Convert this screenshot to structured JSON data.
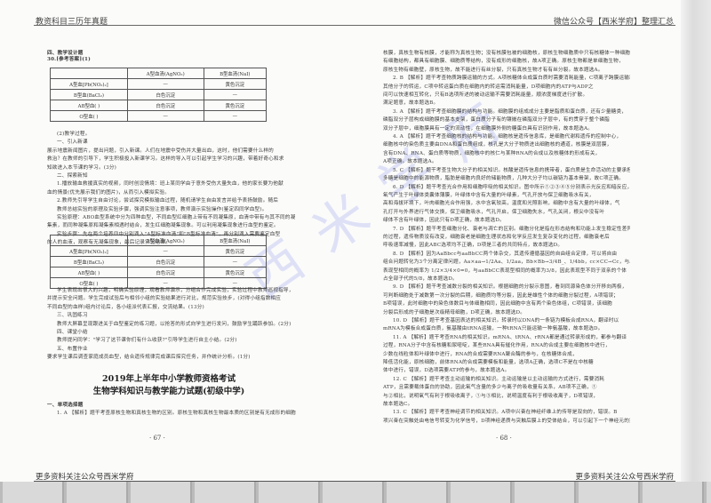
{
  "header": {
    "left": "教资科目三历年真题",
    "right": "微信公众号【西米学府】整理汇总"
  },
  "watermark": "西米学府",
  "left_page": {
    "section": "四、教学设计题",
    "answer_label": "30.[参考答案](1)",
    "table": {
      "headers": [
        "",
        "A型血清(AgNO₃)",
        "B型血清(NaI)"
      ],
      "rows": [
        [
          "A型血[Pb(NO₃)₂]",
          "—",
          "黄色沉淀"
        ],
        [
          "B型血(BaCl₂)",
          "白色沉淀",
          "—"
        ],
        [
          "AB型血(  )",
          "白色沉淀",
          "黄色沉淀"
        ],
        [
          "O型血(  )",
          "—",
          "—"
        ]
      ]
    },
    "para1": [
      "(2)教学过程。",
      "一、引入新课",
      "展示地震新闻图片，提出问题，引入新课。人们在地震中受伤并大量出血，这时，他们需要什么样的",
      "救治？在教师的引导下，学生积极投入新课学习。这样的导入可以引起学生学习的兴趣，带着好奇心和求",
      "知欲进入本节课的学习。(3分)",
      "二、探索新知",
      "1.播放输血救援真实的视频，同时创设情境：班上某同学由于意外受伤大量失血，他的家长要为他献",
      "血的情景(优先展示我们的图片)，从而引入模拟实验。",
      "2.教师先引导学生自由讨论，尝试探究模拟输血过程，随机请学生自由发言并给予表扬鼓励。随后",
      "教师总结实验的原理及实验步骤，强调实验注意事项，教师演示实验操作(鉴定四同学血型)。",
      "实验原理：ABO血型系统中分为四种血型，不同血型红细胞上带有不同凝集原，血清中带有与其不同的凝",
      "集素，而同种凝集原和凝集素相遇时结合，发生红细胞凝集现象。可以利用凝集现象进行血型的鉴定。",
      "实验步骤：先在两个培养皿中分别滴入\"A型标准血清\"和\"B型标准血清\"，再分别滴入需要鉴定血型",
      "的人的血液，观察有无凝集现象，最后记录实验结果。"
    ],
    "para2": [
      "学生表现出很大的兴趣，明确实验原理，观看教师演示，分组合作完成实验，实验过程中教师巡视指导，",
      "并提示安全问题。学生完成试验后与相邻小组的实验结果进行对比，规范实验技步，(对得小组指数相应",
      "不同血型的血样)组内讨论后，各小组派代表汇报，交流结果。(13分)",
      "三、巩固练习",
      "教师大屏幕呈现跟进关于血型鉴定的练习题，以抢答的形式向学生进行发问，鼓励学生踊跃参加。(2分)",
      "四、课堂小结",
      "教师提问同学：\"学习了这节课你们有什么收获?\"引导学生进行自主小结。(2分)",
      "五、布置作业",
      "要求学生课后调查家庭成员血型，结合遗传规律完成课后探究任务，并作统计分析。(1分)"
    ],
    "exam_title_1": "2019年上半年中小学教师资格考试",
    "exam_title_2": "生物学科知识与教学能力试题(初级中学)",
    "section2": "一、单项选择题",
    "q1": "1. A 【解析】题干考查原核生物和真核生物的区别。原核生物和真核生物最本质的区别是有无成形的细胞",
    "page_number": "· 67 ·"
  },
  "right_page": {
    "lines": [
      "核膜，真核生物有核膜，才能称为真核生物；没有核膜包被的细胞核，原核生物细胞质中只有核糖体一种细胞器",
      "有细胞结构，都具有细胞膜、细胞质等结构，没有成形的细胞核，故A项正确。原核生物都是单细胞生物，",
      "原核生物有细胞壁，原核生物，故不能进行有丝分裂，只有真核生物才有有丝分裂。故本题选A。",
      "2. B 【解析】题干考查物质跨膜运输的方式。A项核糖体合成蛋白质时需要消耗能量，C项离子跨膜运输和",
      "其他分子的转运，C项中转运蛋白质在细胞内的转运需消耗能量，D项细胞内的ATP与ADP之",
      "间可以快速相互转化，只有B选项所述的被动运输不需要消耗能量，顺浓度梯度进行扩散。",
      "满足题意，故本题选B。",
      "3. A 【解析】题干考查细胞膜的结构与功能。细胞膜的组成成分主要是脂质和蛋白质，还有少量糖类，",
      "磷脂双分子层构成细胞膜的基本支架，蛋白质分子有的镶嵌在磷脂双分子层中，有的贯穿于整个磷脂",
      "双分子层中，细胞膜具有一定的流动性，在细胞膜外侧的糖蛋白具有识别作用，故本题选A。",
      "4. A 【解析】题干考查细胞核的结构与功能。细胞核是遗传信息库，是细胞代谢和遗传的控制中心，",
      "细胞核中的染色质主要由DNA和蛋白质组成，核孔是大分子物质进出细胞核的通道，核膜是双层膜，",
      "含有DNA、RNA、蛋白质等物质，细胞核中的核仁与某种RNA的合成以及核糖体的形成有关，",
      "A项正确。故本题选A。",
      "5. C 【解析】题干考查生物大分子的相关知识。核酸是遗传信息的携带者，蛋白质是生命活动的主要承担者，",
      "多糖是细胞中的能源物质，脂肪是细胞内良好的储能物质，几种大分子均以碳链为基本骨架，故C项正确。",
      "6. D 【解析】题干考查光合作用和细胞呼吸的相关知识。图中所示①②③④⑤分别表示光反应和暗反应，",
      "氧气产生于叶绿体类囊体薄膜，叶绿体中含有大量的叶绿素，气孔开放与保卫细胞吸水有关，",
      "高和海拔环境下，叶肉细胞光合作用强，水中含氧较高，温度和光照影响，细胞中含有大量的叶绿体，气",
      "孔打开与外界进行气体交换，保卫细胞吸水，气孔开启，保卫细胞失水，气孔关闭，根尖中没有叶",
      "绿体不含有叶绿体，因此只有D项正确，故本题选D。",
      "7. D 【解析】题干考查细胞分化、衰老与凋亡的区别。细胞分化是指在形态结构和功能上发生稳定性差异",
      "的过程，遗传物质没有改变，细胞衰老是细胞生理状态和化学反应发生复杂变化的过程，细胞衰老后",
      "呼吸速率减慢，因此ABC选项均不正确，D项是三者的共同特点，故本题选D。",
      "8. D 【解析】因为AaBbcc与aaBbCC两个体杂交，其遗传遵循基因的自由组合定律，可以将自由",
      "组合问题转化为3个分离定律问题，Aa×aa→1/2Aa、1/2aa，Bb×Bb→3/4B_、1/4bb，cc×CC→Cc，与AaBbcc",
      "表现型相同的概率为 1/2×3/4×0=0，与aaBbCC表现型相同的概率为3/8，因此表现型不同于双亲的个体",
      "占全部子代的5/8，故本题选D。",
      "9. D 【解析】题干考查减数分裂的相关知识。根据细胞的分裂示意图，看到同源染色体分开移向两极，",
      "可判断细胞处于减数第一次分裂的后期，细胞质均等分裂，因此是雄性个体的细胞分裂过程，A项错误；",
      "B项错误，此时细胞中的染色体数目与体细胞相同，因此细胞中含有两个染色体组，C项错误，该细胞",
      "分裂后形成的子细胞是次级精母细胞，D项正确，故本题选D。",
      "10. D 【解析】题干考查基因表达的相关知识。转录时以DNA的一条链为模板合成RNA，翻译时以",
      "mRNA为模板合成蛋白质，氨基酸由tRNA运输，一种tRNA只能运输一种氨基酸，故本题选D。",
      "11. A 【解析】题干考查RNA的相关知识。mRNA、tRNA、rRNA都是通过转录形成的，都参与翻译",
      "过程，RNA分子中含有核糖和尿嘧啶，某些RNA具有催化作用，RNA的合成主要在细胞核中进行，",
      "少数在线粒体和叶绿体中进行，RNA的合成需要RNA聚合酶的参与，在核糖体合成，",
      "降低活化能，原核细胞，前体RNA的合成需要模板和能量，选项A正确，选项C不是在中核糖",
      "体中进行，错误，D选项需要ATP的参与，故本题选A。",
      "12. C 【解析】题干考查主动运输的相关知识。主动运输是以主动运输的方式进行，需要消耗",
      "ATP，且需要载体蛋白的协助，因此氧气含量的多少与离子的吸收量有关系，AB项不正确，①",
      "与②相比，说明氧气有利于根吸收离子，①与③相比，说明温度有利于根吸收离子，D项错误，",
      "故本题选C。",
      "13. C 【解析】题干考查神经调节的相关知识。A项中兴奋在神经纤维上的传导是双向的，错误。B",
      "项兴奋在突触处由电信号转变为化学信号，D项神经递质与突触后膜上的受体结合，可以引起下一个神经元的兴奋"
    ],
    "page_number": "· 68 ·"
  },
  "footer": {
    "left": "更多资料关注公众号西米学府",
    "right": "更多资料关注公众号西米学府"
  }
}
